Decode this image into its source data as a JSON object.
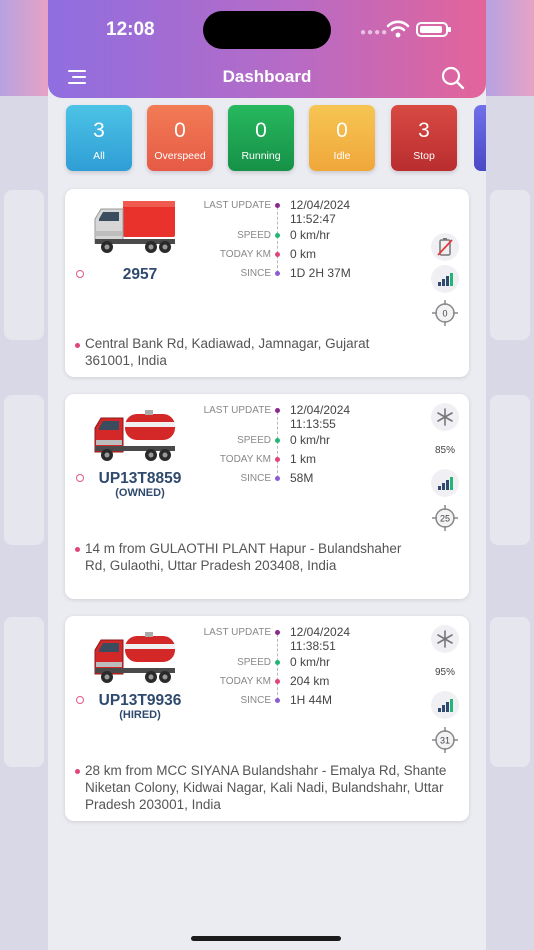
{
  "status_bar": {
    "time": "12:08"
  },
  "header": {
    "title": "Dashboard"
  },
  "tiles": [
    {
      "count": "3",
      "label": "All",
      "color_top": "#4cc3e6",
      "color_bottom": "#2f9ed5"
    },
    {
      "count": "0",
      "label": "Overspeed",
      "color_top": "#f27c55",
      "color_bottom": "#e65a46"
    },
    {
      "count": "0",
      "label": "Running",
      "color_top": "#27b85e",
      "color_bottom": "#169147"
    },
    {
      "count": "0",
      "label": "Idle",
      "color_top": "#f6c553",
      "color_bottom": "#f0a73a"
    },
    {
      "count": "3",
      "label": "Stop",
      "color_top": "#d84a43",
      "color_bottom": "#b92d2f"
    }
  ],
  "labels": {
    "last_update": "LAST UPDATE",
    "speed": "SPEED",
    "today_km": "TODAY KM",
    "since": "SINCE"
  },
  "vehicles": [
    {
      "number": "2957",
      "subtitle": "",
      "truck_color": "#e8322b",
      "last_update_date": "12/04/2024",
      "last_update_time": "11:52:47",
      "speed": "0 km/hr",
      "today_km": "0 km",
      "since": "1D 2H 37M",
      "address": "Central Bank Rd, Kadiawad, Jamnagar, Gujarat 361001, India",
      "fuel_percent": "",
      "count_badge": "0"
    },
    {
      "number": "UP13T8859",
      "subtitle": "(OWNED)",
      "truck_color": "#d42727",
      "last_update_date": "12/04/2024",
      "last_update_time": "11:13:55",
      "speed": "0 km/hr",
      "today_km": "1 km",
      "since": "58M",
      "address": "14 m from GULAOTHI PLANT Hapur - Bulandshaher Rd, Gulaothi, Uttar Pradesh 203408, India",
      "fuel_percent": "85%",
      "count_badge": "25"
    },
    {
      "number": "UP13T9936",
      "subtitle": "(HIRED)",
      "truck_color": "#d42727",
      "last_update_date": "12/04/2024",
      "last_update_time": "11:38:51",
      "speed": "0 km/hr",
      "today_km": "204 km",
      "since": "1H 44M",
      "address": "28 km from MCC SIYANA Bulandshahr - Emalya Rd, Shante Niketan Colony, Kidwai Nagar, Kali Nadi, Bulandshahr, Uttar Pradesh 203001, India",
      "fuel_percent": "95%",
      "count_badge": "31"
    }
  ],
  "colors": {
    "header_start": "#8f6ee0",
    "header_end": "#e3649a",
    "dot_last_update": "#8b2a8c",
    "dot_speed": "#22b573",
    "dot_today_km": "#e0457a",
    "dot_since": "#8b5cd6",
    "vehicle_text": "#2f4a6e"
  },
  "icons": {
    "menu": "menu-icon",
    "search": "search-icon",
    "battery_off": "battery-off-icon",
    "signal": "signal-bars-icon",
    "crosshair": "crosshair-icon",
    "ac": "snowflake-icon"
  }
}
